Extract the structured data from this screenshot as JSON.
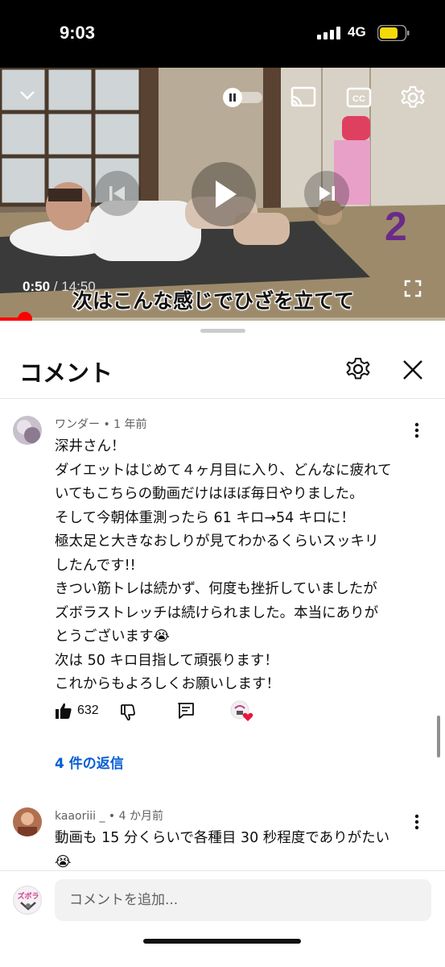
{
  "status_bar": {
    "time": "9:03",
    "network": "4G"
  },
  "player": {
    "current_time": "0:50",
    "duration": " / 14:50",
    "caption": "次はこんな感じでひざを立てて",
    "overlay_number": "2",
    "progress": 0.056,
    "icons": [
      "chevron-down-icon",
      "autoplay-toggle-icon",
      "cast-icon",
      "closed-captions-icon",
      "settings-gear-icon",
      "previous-icon",
      "play-icon",
      "next-icon",
      "fullscreen-icon"
    ]
  },
  "comments_panel": {
    "title": "コメント",
    "comments": [
      {
        "author_meta": "ワンダー • 1 年前",
        "text": "深井さん！\nダイエットはじめて４ヶ月目に入り、どんなに疲れて\nいてもこちらの動画だけはほぼ毎日やりました。\nそして今朝体重測ったら 61 キロ→54 キロに！\n極太足と大きなおしりが見てわかるくらいスッキリ\nしたんです!!\nきつい筋トレは続かず、何度も挫折していましたが\nズボラストレッチは続けられました。本当にありが\nとうございます😭\n次は 50 キロ目指して頑張ります！\nこれからもよろしくお願いします！",
        "likes": "632",
        "replies_label": "4 件の返信"
      },
      {
        "author_meta": "kaaoriii _ • 4 か月前",
        "text": "動画も 15 分くらいで各種目 30 秒程度でありがたい\n😭"
      }
    ],
    "composer_placeholder": "コメントを追加...",
    "creator_avatar_text": "ズボラ"
  },
  "colors": {
    "accent_red": "#ff0000",
    "link_blue": "#065fd4",
    "heart": "#e8163b"
  }
}
